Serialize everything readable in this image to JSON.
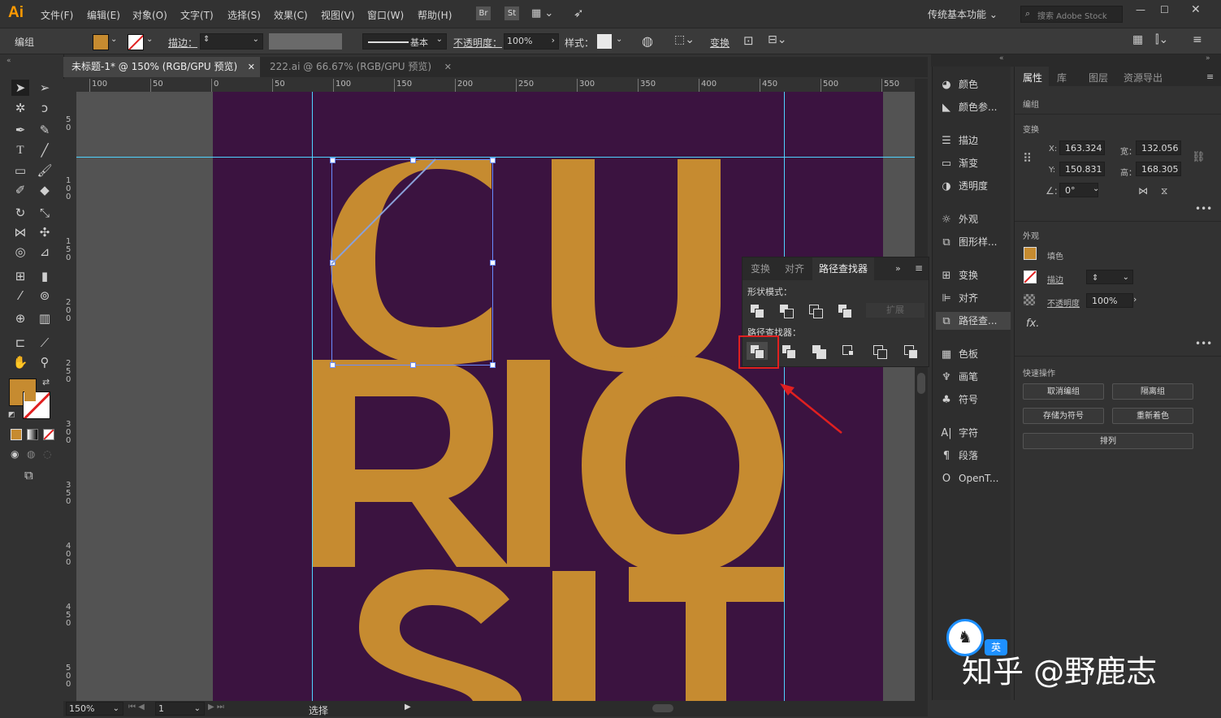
{
  "app": {
    "logo": "Ai",
    "workspace": "传统基本功能",
    "search_placeholder": "搜索 Adobe Stock"
  },
  "menu": [
    "文件(F)",
    "编辑(E)",
    "对象(O)",
    "文字(T)",
    "选择(S)",
    "效果(C)",
    "视图(V)",
    "窗口(W)",
    "帮助(H)"
  ],
  "menu_badges": [
    "Br",
    "St"
  ],
  "control_bar": {
    "selection": "编组",
    "stroke_label": "描边：",
    "stroke_profile": "基本",
    "opacity_label": "不透明度：",
    "opacity_value": "100%",
    "style_label": "样式：",
    "transform_label": "变换"
  },
  "tabs": [
    {
      "label": "未标题-1* @ 150% (RGB/GPU 预览)",
      "active": true
    },
    {
      "label": "222.ai @ 66.67% (RGB/GPU 预览)",
      "active": false
    }
  ],
  "ruler_h": [
    "100",
    "50",
    "0",
    "50",
    "100",
    "150",
    "200",
    "250",
    "300",
    "350",
    "400",
    "450",
    "500",
    "550"
  ],
  "ruler_v": [
    "5 0",
    "1 0 0",
    "1 5 0",
    "2 0 0",
    "2 5 0",
    "3 0 0",
    "3 5 0",
    "4 0 0",
    "4 5 0",
    "5 0 0"
  ],
  "artwork": {
    "rows": [
      "CU",
      "RIO",
      "SIT"
    ],
    "fill": "#c68b30",
    "background": "#3b1340"
  },
  "status": {
    "zoom": "150%",
    "page": "1",
    "mode": "选择"
  },
  "pathfinder": {
    "tabs": [
      "变换",
      "对齐",
      "路径查找器"
    ],
    "shape_modes_label": "形状模式：",
    "expand_label": "扩展",
    "pathfinders_label": "路径查找器："
  },
  "mid_panel": [
    "颜色",
    "颜色参...",
    "描边",
    "渐变",
    "透明度",
    "外观",
    "图形样...",
    "变换",
    "对齐",
    "路径查...",
    "色板",
    "画笔",
    "符号",
    "字符",
    "段落",
    "OpenT..."
  ],
  "properties": {
    "tabs": [
      "属性",
      "库",
      "图层",
      "资源导出"
    ],
    "selection": "编组",
    "transform_label": "变换",
    "x_label": "X:",
    "x": "163.324",
    "y_label": "Y:",
    "y": "150.831",
    "w_label": "宽：",
    "w": "132.056",
    "h_label": "高：",
    "h": "168.305",
    "angle": "0°",
    "appearance_label": "外观",
    "fill_label": "填色",
    "stroke_label": "描边",
    "opacity_label": "不透明度",
    "opacity": "100%",
    "fx": "fx.",
    "quick_actions_label": "快速操作",
    "quick_actions": [
      "取消编组",
      "隔离组",
      "存储为符号",
      "重新着色",
      "排列"
    ]
  },
  "watermark": {
    "badge": "英",
    "text": "知乎 @野鹿志"
  },
  "colors": {
    "accent_fill": "#c68b30",
    "guide": "#4fd3ff",
    "highlight": "#e02020"
  }
}
